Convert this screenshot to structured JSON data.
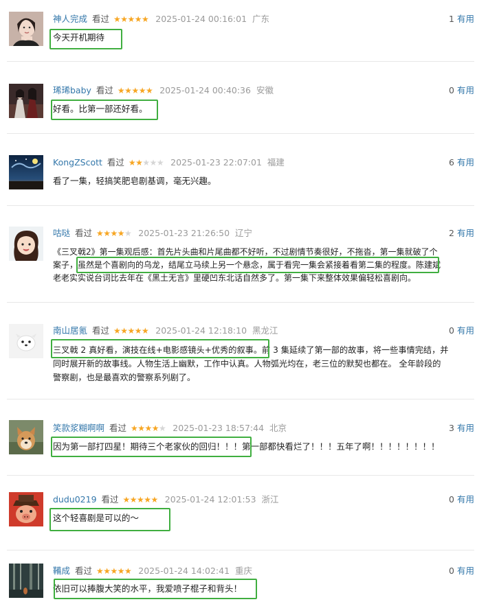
{
  "comments": [
    {
      "user": "神人完成",
      "status": "看过",
      "rating": 5,
      "time": "2025-01-24 00:16:01",
      "location": "广东",
      "votes": "1",
      "votes_label": "有用",
      "paragraphs": [
        "今天开机期待"
      ],
      "avatar": "avatar-girl-portrait"
    },
    {
      "user": "琋琋baby",
      "status": "看过",
      "rating": 5,
      "time": "2025-01-24 00:40:36",
      "location": "安徽",
      "votes": "0",
      "votes_label": "有用",
      "paragraphs": [
        "好看。比第一部还好看。"
      ],
      "avatar": "avatar-dark-figures"
    },
    {
      "user": "KongZScott",
      "status": "看过",
      "rating": 2,
      "time": "2025-01-23 22:07:01",
      "location": "福建",
      "votes": "6",
      "votes_label": "有用",
      "paragraphs": [
        "看了一集，轻搞笑肥皂剧基调，毫无兴趣。"
      ],
      "avatar": "avatar-starry-night"
    },
    {
      "user": "咕哒",
      "status": "看过",
      "rating": 4,
      "time": "2025-01-23 21:26:50",
      "location": "辽宁",
      "votes": "2",
      "votes_label": "有用",
      "paragraphs": [
        "《三叉戟2》第一集观后感：首先片头曲和片尾曲都不好听，不过剧情节奏很好，不拖沓，第一集就破了个",
        "案子，虽然是个喜剧向的乌龙，结尾立马续上另一个悬念，属于看完一集会紧接着看第二集的程度。陈建斌",
        "老老实实说台词比去年在《黑土无言》里硬凹东北话自然多了。第一集下来整体效果偏轻松喜剧向。"
      ],
      "avatar": "avatar-child"
    },
    {
      "user": "南山居氪",
      "status": "看过",
      "rating": 5,
      "time": "2025-01-24 12:18:10",
      "location": "黑龙江",
      "votes": "0",
      "votes_label": "有用",
      "paragraphs": [
        "三叉戟 2 真好看，演技在线+电影感镜头+优秀的叙事。前 3 集延续了第一部的故事，将一些事情完结，并",
        "同时展开新的故事线。人物生活上幽默，工作中认真。人物弧光均在，老三位的默契也都在。 全年龄段的",
        "警察剧，也是最喜欢的警察系列剧了。"
      ],
      "avatar": "avatar-white-dog"
    },
    {
      "user": "笑款浆糊啊啊",
      "status": "看过",
      "rating": 4,
      "time": "2025-01-23 18:57:44",
      "location": "北京",
      "votes": "3",
      "votes_label": "有用",
      "paragraphs": [
        "因为第一部打四星！期待三个老家伙的回归！！！第一部都快看烂了！！！五年了啊！！！！！！！！"
      ],
      "avatar": "avatar-shiba-dog"
    },
    {
      "user": "dudu0219",
      "status": "看过",
      "rating": 5,
      "time": "2025-01-24 12:01:53",
      "location": "浙江",
      "votes": "0",
      "votes_label": "有用",
      "paragraphs": [
        "这个轻喜剧是可以的～"
      ],
      "avatar": "avatar-cartoon-pig"
    },
    {
      "user": "鞴成",
      "status": "看过",
      "rating": 5,
      "time": "2025-01-24 14:02:41",
      "location": "重庆",
      "votes": "0",
      "votes_label": "有用",
      "paragraphs": [
        "依旧可以捧腹大笑的水平，我爱喷子棍子和背头！"
      ],
      "avatar": "avatar-forest"
    }
  ]
}
